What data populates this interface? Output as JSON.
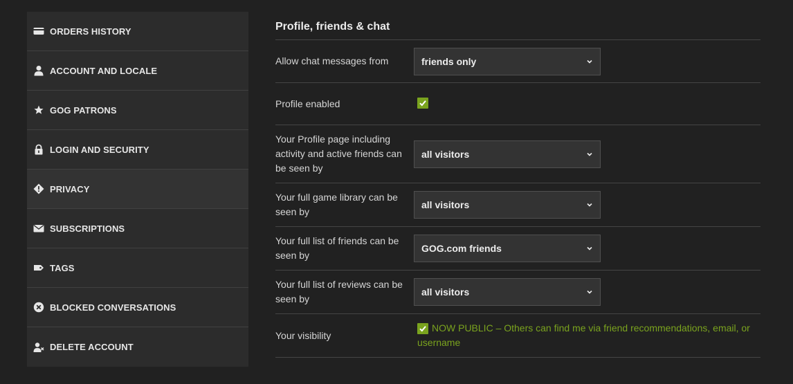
{
  "sidebar": {
    "items": [
      {
        "label": "ORDERS HISTORY",
        "icon": "credit-card-icon"
      },
      {
        "label": "ACCOUNT AND LOCALE",
        "icon": "user-icon"
      },
      {
        "label": "GOG PATRONS",
        "icon": "star-icon"
      },
      {
        "label": "LOGIN AND SECURITY",
        "icon": "lock-icon"
      },
      {
        "label": "PRIVACY",
        "icon": "privacy-diamond-icon"
      },
      {
        "label": "SUBSCRIPTIONS",
        "icon": "envelope-icon"
      },
      {
        "label": "TAGS",
        "icon": "tag-icon"
      },
      {
        "label": "BLOCKED CONVERSATIONS",
        "icon": "blocked-x-icon"
      },
      {
        "label": "DELETE ACCOUNT",
        "icon": "user-remove-icon"
      }
    ],
    "active": "PRIVACY"
  },
  "main": {
    "title": "Profile, friends & chat",
    "rows": {
      "chat": {
        "label": "Allow chat messages from",
        "value": "friends only"
      },
      "profile_enabled": {
        "label": "Profile enabled",
        "checked": true
      },
      "profile_page": {
        "label": "Your Profile page including activity and active friends can be seen by",
        "value": "all visitors"
      },
      "game_library": {
        "label": "Your full game library can be seen by",
        "value": "all visitors"
      },
      "friends_list": {
        "label": "Your full list of friends can be seen by",
        "value": "GOG.com friends"
      },
      "reviews_list": {
        "label": "Your full list of reviews can be seen by",
        "value": "all visitors"
      },
      "visibility": {
        "label": "Your visibility",
        "text": "NOW PUBLIC – Others can find me via friend recommendations, email, or username",
        "checked": true
      }
    }
  },
  "colors": {
    "background": "#212121",
    "sidebar": "#2c2c2c",
    "accent_green": "#7aa31e"
  }
}
